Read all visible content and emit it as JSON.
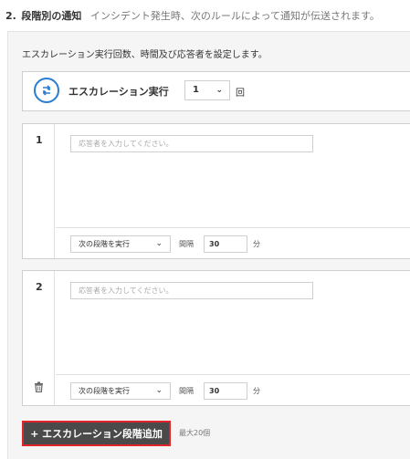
{
  "header": {
    "step_number": "2.",
    "title": "段階別の通知",
    "description": "インシデント発生時、次のルールによって通知が伝送されます。"
  },
  "panel": {
    "description": "エスカレーション実行回数、時間及び応答者を設定します。"
  },
  "execution": {
    "icon": "repeat-icon",
    "label": "エスカレーション実行",
    "count": "1",
    "unit": "回"
  },
  "stages": [
    {
      "number": "1",
      "responder_placeholder": "応答者を入力してください。",
      "next_action": "次の段階を実行",
      "interval_label": "間隔",
      "interval_value": "30",
      "interval_unit": "分"
    },
    {
      "number": "2",
      "responder_placeholder": "応答者を入力してください。",
      "next_action": "次の段階を実行",
      "interval_label": "間隔",
      "interval_value": "30",
      "interval_unit": "分"
    }
  ],
  "add_button": {
    "label": "+ エスカレーション段階追加"
  },
  "max_note": "最大20個",
  "colors": {
    "accent": "#2b7cd3",
    "button_bg": "#4a4a4a",
    "highlight_border": "#e0242a"
  }
}
